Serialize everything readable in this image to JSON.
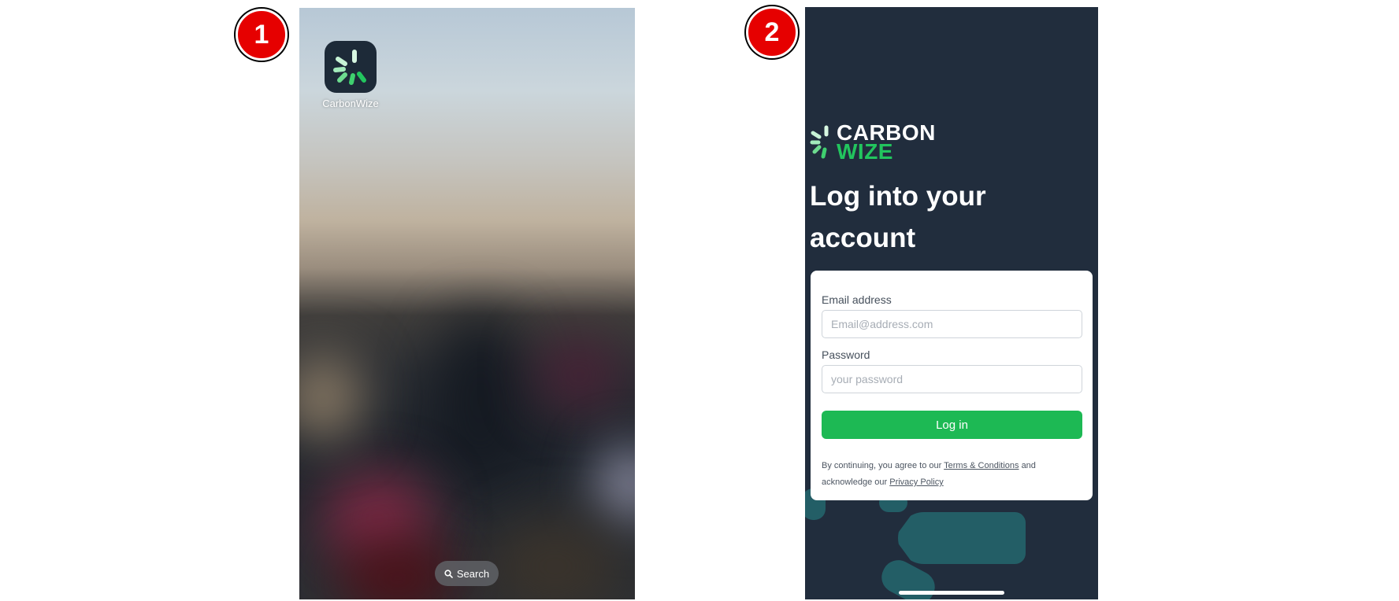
{
  "steps": {
    "step1": "1",
    "step2": "2"
  },
  "home_screen": {
    "app": {
      "name": "CarbonWize",
      "icon": "carbonwize-logo-icon",
      "tile_color": "#1d2a38",
      "accent_color": "#22c55e"
    },
    "search": {
      "label": "Search",
      "icon": "search-icon"
    }
  },
  "login_screen": {
    "background_color": "#212d3d",
    "logo": {
      "line1": "CARBON",
      "line2": "WIZE",
      "line1_color": "#ffffff",
      "line2_color": "#22c55e"
    },
    "title": "Log into your account",
    "form": {
      "email_label": "Email address",
      "email_placeholder": "Email@address.com",
      "email_value": "",
      "password_label": "Password",
      "password_placeholder": "your password",
      "password_value": "",
      "submit_label": "Log in",
      "submit_color": "#1db954"
    },
    "legal": {
      "prefix": "By continuing, you agree to our",
      "terms_link": "Terms & Conditions",
      "middle": "and acknowledge our",
      "privacy_link": "Privacy Policy"
    }
  }
}
